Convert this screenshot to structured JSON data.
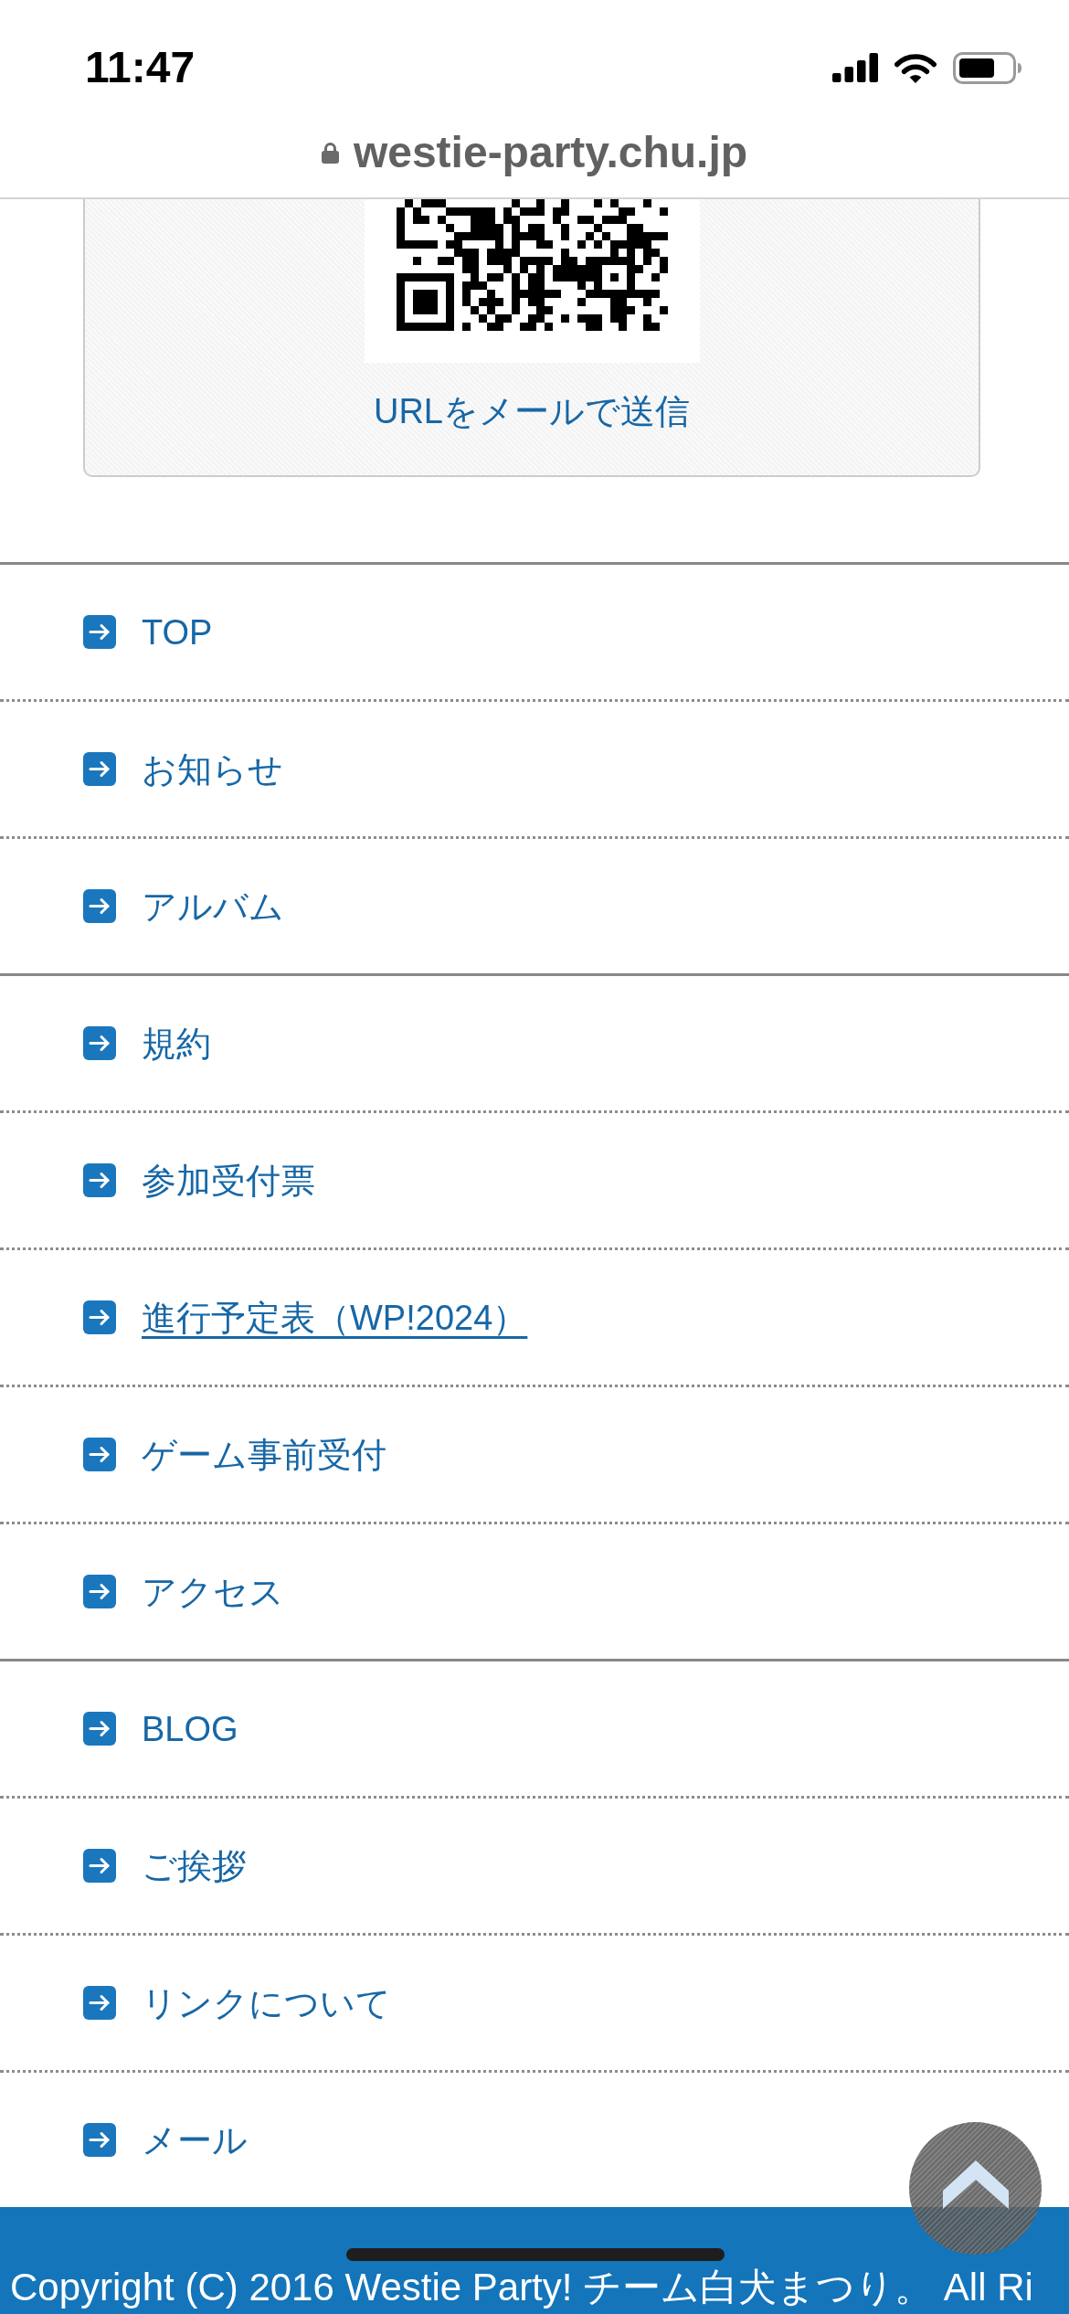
{
  "status_bar": {
    "time": "11:47"
  },
  "address_bar": {
    "url": "westie-party.chu.jp",
    "secure": true
  },
  "share_card": {
    "link": "URLをメールで送信"
  },
  "menu_groups": [
    {
      "items": [
        {
          "label": "TOP",
          "underlined": false
        },
        {
          "label": "お知らせ",
          "underlined": false
        },
        {
          "label": "アルバム",
          "underlined": false
        }
      ]
    },
    {
      "items": [
        {
          "label": "規約",
          "underlined": false
        },
        {
          "label": "参加受付票",
          "underlined": false
        },
        {
          "label": "進行予定表（WP!2024）",
          "underlined": true
        },
        {
          "label": "ゲーム事前受付",
          "underlined": false
        },
        {
          "label": "アクセス",
          "underlined": false
        }
      ]
    },
    {
      "items": [
        {
          "label": "BLOG",
          "underlined": false
        },
        {
          "label": "ご挨拶",
          "underlined": false
        },
        {
          "label": "リンクについて",
          "underlined": false
        },
        {
          "label": "メール",
          "underlined": false
        }
      ]
    }
  ],
  "footer": {
    "copyright": "Copyright (C) 2016 Westie Party! チーム白犬まつり。 All Ri"
  }
}
